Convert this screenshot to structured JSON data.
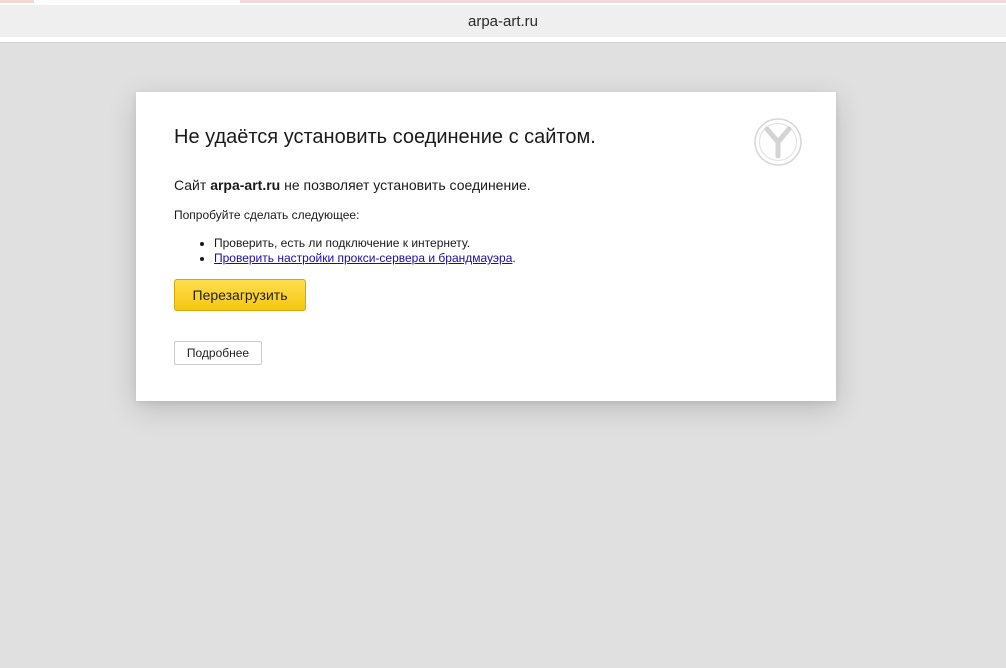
{
  "address_bar": {
    "domain": "arpa-art.ru"
  },
  "error": {
    "icon": "yandex-browser-logo-icon",
    "title": "Не удаётся установить соединение с сайтом.",
    "description_prefix": "Сайт ",
    "description_domain": "arpa-art.ru",
    "description_suffix": " не позволяет установить соединение.",
    "suggestions_heading": "Попробуйте сделать следующее:",
    "suggestions": [
      {
        "text": "Проверить, есть ли подключение к интернету.",
        "link_text": "",
        "link_suffix": ""
      },
      {
        "text": "",
        "link_text": "Проверить настройки прокси-сервера и брандмауэра",
        "link_suffix": "."
      }
    ],
    "reload_label": "Перезагрузить",
    "details_label": "Подробнее"
  },
  "colors": {
    "page_background": "#e0e0e0",
    "reload_button": "#f8cf27",
    "link": "#1a0dab"
  }
}
